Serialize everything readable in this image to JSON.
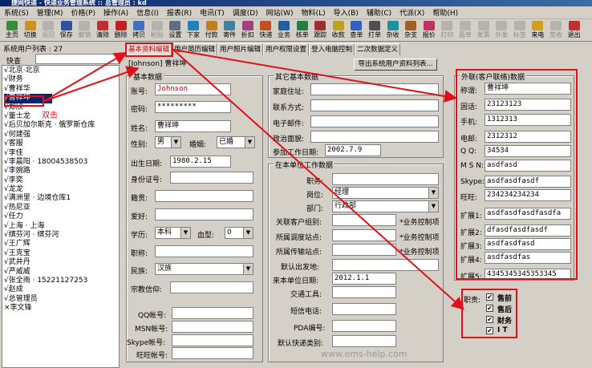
{
  "titlebar": {
    "title": "捷网快递 - 快递业务管理系统 :: 总管理员 : kd"
  },
  "menu": [
    "系统(S)",
    "管理(M)",
    "价格(P)",
    "操作(A)",
    "信息(I)",
    "报表(R)",
    "电讯(T)",
    "调度(D)",
    "网站(W)",
    "物料(L)",
    "导入(B)",
    "辅助(C)",
    "代派(X)",
    "帮助(H)"
  ],
  "toolbar": [
    {
      "label": "主页",
      "icon": "home-icon",
      "color": "#3c8a3c",
      "disabled": false
    },
    {
      "label": "切换",
      "icon": "switch-icon",
      "color": "#d09020",
      "disabled": false
    },
    {
      "label": "返回",
      "icon": "back-icon",
      "color": "#909090",
      "disabled": true
    },
    {
      "label": "保存",
      "icon": "save-icon",
      "color": "#3050a0",
      "disabled": false
    },
    {
      "label": "撤销",
      "icon": "undo-icon",
      "color": "#909090",
      "disabled": true
    },
    {
      "label": "清除",
      "icon": "clear-icon",
      "color": "#c03030",
      "disabled": false
    },
    {
      "label": "删除",
      "icon": "delete-icon",
      "color": "#c02020",
      "disabled": false
    },
    {
      "label": "拷贝",
      "icon": "copy-icon",
      "color": "#4070c0",
      "disabled": false
    },
    {
      "label": "粘贴",
      "icon": "paste-icon",
      "color": "#909090",
      "disabled": true
    },
    {
      "label": "设置",
      "icon": "settings-icon",
      "color": "#607080",
      "disabled": false
    },
    {
      "label": "下家",
      "icon": "next-icon",
      "color": "#2080c0",
      "disabled": false
    },
    {
      "label": "付款",
      "icon": "payment-icon",
      "color": "#c08020",
      "disabled": false
    },
    {
      "label": "寄件",
      "icon": "send-icon",
      "color": "#4080a0",
      "disabled": false
    },
    {
      "label": "折扣",
      "icon": "discount-icon",
      "color": "#a04080",
      "disabled": false
    },
    {
      "label": "快递",
      "icon": "express-icon",
      "color": "#c05020",
      "disabled": false
    },
    {
      "label": "业务",
      "icon": "business-icon",
      "color": "#2060a0",
      "disabled": false
    },
    {
      "label": "核单",
      "icon": "check-order-icon",
      "color": "#208040",
      "disabled": false
    },
    {
      "label": "跟踪",
      "icon": "track-icon",
      "color": "#a03030",
      "disabled": false
    },
    {
      "label": "收款",
      "icon": "receive-icon",
      "color": "#c0a020",
      "disabled": false
    },
    {
      "label": "查单",
      "icon": "search-order-icon",
      "color": "#3060c0",
      "disabled": false
    },
    {
      "label": "打单",
      "icon": "print-order-icon",
      "color": "#505050",
      "disabled": false
    },
    {
      "label": "杂收",
      "icon": "misc-income-icon",
      "color": "#2090a0",
      "disabled": false
    },
    {
      "label": "杂支",
      "icon": "misc-expense-icon",
      "color": "#a06020",
      "disabled": false
    },
    {
      "label": "报价",
      "icon": "quote-icon",
      "color": "#c03060",
      "disabled": false
    },
    {
      "label": "打印",
      "icon": "print-icon",
      "color": "#909090",
      "disabled": true
    },
    {
      "label": "面单",
      "icon": "waybill-icon",
      "color": "#909090",
      "disabled": true
    },
    {
      "label": "发票",
      "icon": "invoice-icon",
      "color": "#909090",
      "disabled": true
    },
    {
      "label": "外发",
      "icon": "outsource-icon",
      "color": "#909090",
      "disabled": true
    },
    {
      "label": "标签",
      "icon": "label-icon",
      "color": "#909090",
      "disabled": true
    },
    {
      "label": "来电",
      "icon": "phone-icon",
      "color": "#d0a020",
      "disabled": false
    },
    {
      "label": "签收",
      "icon": "sign-icon",
      "color": "#909090",
      "disabled": true
    },
    {
      "label": "退出",
      "icon": "exit-icon",
      "color": "#c03030",
      "disabled": false
    }
  ],
  "sidebar": {
    "title": "系统用户列表 : 27",
    "search_label": "快查",
    "items": [
      "√北京·北京",
      "√财务",
      "√曹祥华",
      "√曹祥坤",
      "√郑欣",
      "√董士龙",
      "√后贝加尔斯克 · 俄罗斯仓库",
      "√何建强",
      "√客服",
      "√李佳",
      "√李晨阳 · 18004538503",
      "√李婉路",
      "√李奕",
      "√龙龙",
      "√满洲里 · 边境仓库1",
      "√热尼亚",
      "√任力",
      "√上海 · 上海",
      "√缤芬河 · 缤芬河",
      "√王广辉",
      "√王克宝",
      "√武井丹",
      "√严威威",
      "√张全雨 · 15221127253",
      "√赵成",
      "√总管理员",
      "×李文锋"
    ],
    "selected_index": 3
  },
  "tabs": [
    "基本资料编辑",
    "用户简历编辑",
    "用户照片编辑",
    "用户权限设置",
    "登入电脑控制",
    "二次数据定义"
  ],
  "user_line": "[Johnson] 曹祥坤",
  "export_button": "导出系统用户资料列表...",
  "basic": {
    "title": "基本数据",
    "account_label": "账号:",
    "account": "Johnson",
    "password_label": "密码:",
    "password": "*********",
    "name_label": "姓名:",
    "name": "曹祥坤",
    "gender_label": "性别:",
    "gender": "男",
    "marital_label": "婚姻:",
    "marital": "已婚",
    "birth_label": "出生日期:",
    "birth": "1980.2.15",
    "idcard_label": "身份证号:",
    "idcard": "",
    "native_label": "籍贯:",
    "native": "",
    "hobby_label": "爱好:",
    "hobby": "",
    "edu_label": "学历:",
    "edu": "本科",
    "blood_label": "血型:",
    "blood": "0",
    "title_label": "职称:",
    "title_val": "",
    "ethnic_label": "民族:",
    "ethnic": "汉族",
    "religion_label": "宗教信仰:",
    "religion": "",
    "qq_label": "QQ帐号:",
    "qq": "",
    "msn_label": "MSN帐号:",
    "msn": "",
    "skype_label": "Skype帐号:",
    "skype": "",
    "wangwang_label": "旺旺帐号:",
    "wangwang": ""
  },
  "other": {
    "title": "其它基本数据",
    "home_label": "家庭住址:",
    "home": "",
    "contact_label": "联系方式:",
    "contact": "",
    "email_label": "电子邮件:",
    "email": "",
    "politics_label": "政治面貌:",
    "politics": "",
    "workdate_label": "参加工作日期:",
    "workdate": "2002.7.9"
  },
  "work": {
    "title": "在本单位工作数据",
    "duty_label": "职务:",
    "duty": "",
    "post_label": "岗位:",
    "post": "经理",
    "dept_label": "部门:",
    "dept": "行政部",
    "group_label": "关联客户组别:",
    "site_label": "所属调度站点:",
    "transit_label": "所属传输站点:",
    "biz_control": "*业务控制项",
    "dispatch_label": "默认出发地:",
    "dispatch": "",
    "joindate_label": "来本单位日期:",
    "joindate": "2012.1.1",
    "transport_label": "交通工具:",
    "transport": "",
    "sms_label": "短信电话:",
    "sms": "",
    "pda_label": "PDA编号:",
    "pda": "",
    "courier_label": "默认快递类别:",
    "courier": ""
  },
  "contact": {
    "title": "外联(客户联络)数据",
    "rows": [
      {
        "label": "称谓:",
        "value": "曹祥坤"
      },
      {
        "label": "固话:",
        "value": "23123123"
      },
      {
        "label": "手机:",
        "value": "1312313"
      },
      {
        "label": "电邮:",
        "value": "2312312"
      },
      {
        "label": "Q Q:",
        "value": "34534"
      },
      {
        "label": "M S N:",
        "value": "asdfasd"
      },
      {
        "label": "Skype:",
        "value": "asdfasdfasdf"
      },
      {
        "label": "旺旺:",
        "value": "234234234234"
      },
      {
        "label": "扩展1:",
        "value": "asdfasdfasdfasdfa"
      },
      {
        "label": "扩展2:",
        "value": "dfasdfasdfasdf"
      },
      {
        "label": "扩展3:",
        "value": "asdfasdfasd"
      },
      {
        "label": "扩展4:",
        "value": "asdfasdfas"
      },
      {
        "label": "扩展5:",
        "value": "4345345345353345"
      }
    ]
  },
  "duties": {
    "label": "职责:",
    "items": [
      {
        "label": "售前",
        "checked": true
      },
      {
        "label": "售后",
        "checked": true
      },
      {
        "label": "财务",
        "checked": true
      },
      {
        "label": "I T",
        "checked": true
      }
    ]
  },
  "annotation": {
    "text": "双击",
    "color": "#e0101a"
  },
  "watermark": "www.ems-help.com"
}
